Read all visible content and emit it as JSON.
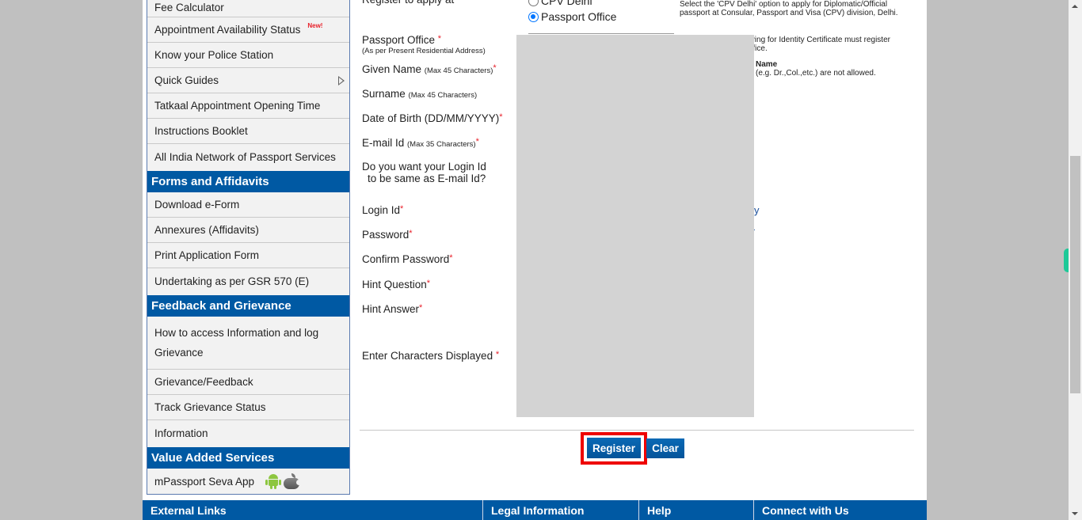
{
  "sidebar": {
    "group1_items": [
      {
        "label": "Fee Calculator"
      },
      {
        "label": "Appointment Availability Status",
        "badge": "New!"
      },
      {
        "label": "Know your Police Station"
      },
      {
        "label": "Quick Guides",
        "has_submenu": true
      },
      {
        "label": "Tatkaal Appointment Opening Time"
      },
      {
        "label": "Instructions Booklet"
      },
      {
        "label": "All India Network of Passport Services"
      }
    ],
    "forms_heading": "Forms and Affidavits",
    "forms_items": [
      {
        "label": "Download e-Form"
      },
      {
        "label": "Annexures (Affidavits)"
      },
      {
        "label": "Print Application Form"
      },
      {
        "label": "Undertaking as per GSR 570 (E)"
      }
    ],
    "feedback_heading": "Feedback and Grievance",
    "feedback_items": [
      {
        "label": "How to access Information and log Grievance"
      },
      {
        "label": "Grievance/Feedback"
      },
      {
        "label": "Track Grievance Status"
      },
      {
        "label": "Information"
      }
    ],
    "vas_heading": "Value Added Services",
    "vas_items": [
      {
        "label": "mPassport Seva App",
        "icons": [
          "android-icon",
          "apple-icon"
        ]
      }
    ]
  },
  "form": {
    "register_apply_at": "Register to apply at",
    "options": [
      {
        "label": "CPV Delhi",
        "checked": false
      },
      {
        "label": "Passport Office",
        "checked": true
      }
    ],
    "required_mark": "*",
    "fields": {
      "passport_office": {
        "label": "Passport Office ",
        "hint": "(As per Present Residential Address)"
      },
      "given_name": {
        "label": "Given Name ",
        "hint": "(Max 45 Characters)"
      },
      "surname": {
        "label": "Surname ",
        "hint": "(Max 45 Characters)"
      },
      "dob": {
        "label": "Date of Birth (DD/MM/YYYY)"
      },
      "email": {
        "label": "E-mail Id ",
        "hint": "(Max 35 Characters)"
      },
      "login_same": {
        "line1": "Do you want your Login Id",
        "line2": "to be same as E-mail Id?"
      },
      "login_id": {
        "label": "Login Id"
      },
      "password": {
        "label": "Password"
      },
      "confirm_password": {
        "label": "Confirm Password"
      },
      "hint_question": {
        "label": "Hint Question"
      },
      "hint_answer": {
        "label": "Hint Answer"
      },
      "captcha": {
        "label": "Enter Characters Displayed "
      }
    },
    "notes": {
      "cpv_line1": "Select the 'CPV Delhi' option to apply for Diplomatic/Official",
      "cpv_line2": "passport at Consular, Passport and Visa (CPV) division, Delhi.",
      "ic_line1": "plying for Identity Certificate must register",
      "ic_line2": "Office.",
      "name_heading": "Name",
      "name_line": "(e.g. Dr.,Col.,etc.) are not allowed.",
      "link_fragment": "y",
      "dot_fragment": "."
    },
    "buttons": {
      "register": "Register",
      "clear": "Clear"
    }
  },
  "footer": {
    "columns": [
      "External Links",
      "Legal Information",
      "Help",
      "Connect with Us"
    ]
  },
  "colors": {
    "brand_blue": "#0059a3",
    "required_red": "#e8202a",
    "focus_red": "#ee0000",
    "side_tab_green": "#1ec998"
  }
}
